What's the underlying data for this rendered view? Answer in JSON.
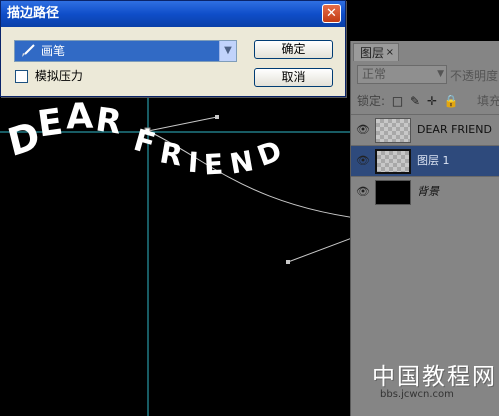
{
  "dialog": {
    "title": "描边路径",
    "close_glyph": "✕",
    "tool": "画笔",
    "checkbox_label": "模拟压力",
    "ok": "确定",
    "cancel": "取消"
  },
  "canvas": {
    "line1": [
      "D",
      "E",
      "A",
      "R"
    ],
    "line2": [
      "F",
      "R",
      "I",
      "E",
      "N",
      "D"
    ]
  },
  "layers_panel": {
    "tab_label": "图层",
    "tab_close": "×",
    "blend_mode": "正常",
    "opacity_label": "不透明度",
    "lock_label": "锁定:",
    "lock_icons": [
      "□",
      "✎",
      "✛",
      "🔒"
    ],
    "fill_label": "填充",
    "layers": [
      {
        "name": "DEAR FRIEND",
        "thumb": "checker",
        "selected": false
      },
      {
        "name": "图层 1",
        "thumb": "checker",
        "selected": true
      },
      {
        "name": "背景",
        "thumb": "black",
        "selected": false
      }
    ]
  },
  "watermark": {
    "title": "中国教程网",
    "url": "bbs.jcwcn.com"
  },
  "colors": {
    "guide": "#2fb7c8",
    "path": "#bfbfbf",
    "selection": "#316ac5",
    "titlebar": "#0f4ec9"
  }
}
